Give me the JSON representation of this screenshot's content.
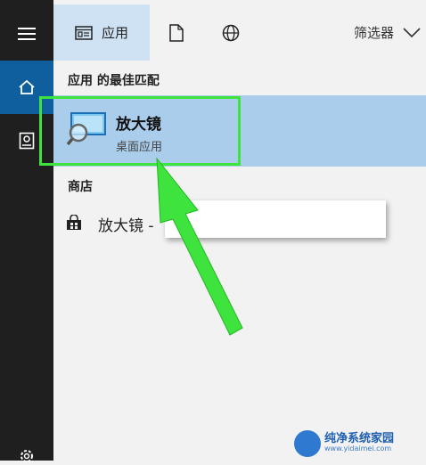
{
  "header": {
    "tabs": [
      {
        "label": "应用",
        "icon": "apps-icon"
      },
      {
        "label": "",
        "icon": "document-icon"
      },
      {
        "label": "",
        "icon": "globe-icon"
      }
    ],
    "filter_label": "筛选器"
  },
  "results": {
    "best_match_heading": "应用 的最佳匹配",
    "best_match": {
      "title": "放大镜",
      "subtitle": "桌面应用",
      "icon": "magnifier-app-icon"
    },
    "store_heading": "商店",
    "store_item": {
      "name": "放大镜 - ",
      "icon": "store-bag-icon"
    }
  },
  "watermark": {
    "title": "纯净系统家园",
    "url": "www.yidaimei.com"
  },
  "colors": {
    "sidebar": "#1f1f1f",
    "sidebar_active": "#0f5e9e",
    "tab_active": "#cfe2f3",
    "best_match_bg": "#a9cdeb",
    "annotation": "#3ee33e"
  }
}
